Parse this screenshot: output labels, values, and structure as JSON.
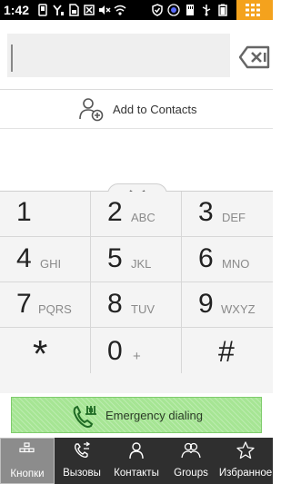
{
  "status_bar": {
    "time": "1:42",
    "icons_left": [
      "phone-icon",
      "signal-y-icon",
      "sim-card-icon",
      "no-sim-icon",
      "mute-icon",
      "wifi-icon"
    ],
    "icons_right": [
      "shield-icon",
      "sync-icon",
      "sd-card-icon",
      "usb-icon",
      "battery-icon"
    ],
    "grid_color": "#f4a21d"
  },
  "dialer": {
    "number_value": "",
    "add_to_contacts": "Add to Contacts",
    "keys": [
      {
        "digit": "1",
        "letters": ""
      },
      {
        "digit": "2",
        "letters": "ABC"
      },
      {
        "digit": "3",
        "letters": "DEF"
      },
      {
        "digit": "4",
        "letters": "GHI"
      },
      {
        "digit": "5",
        "letters": "JKL"
      },
      {
        "digit": "6",
        "letters": "MNO"
      },
      {
        "digit": "7",
        "letters": "PQRS"
      },
      {
        "digit": "8",
        "letters": "TUV"
      },
      {
        "digit": "9",
        "letters": "WXYZ"
      },
      {
        "digit": "*",
        "letters": ""
      },
      {
        "digit": "0",
        "letters": "+"
      },
      {
        "digit": "#",
        "letters": ""
      }
    ],
    "emergency_label": "Emergency dialing",
    "emergency_color": "#a6e594"
  },
  "tabs": [
    {
      "label": "Кнопки",
      "icon": "dialpad-icon",
      "active": true
    },
    {
      "label": "Вызовы",
      "icon": "call-log-icon",
      "active": false
    },
    {
      "label": "Контакты",
      "icon": "person-icon",
      "active": false
    },
    {
      "label": "Groups",
      "icon": "group-icon",
      "active": false
    },
    {
      "label": "Избранное",
      "icon": "star-icon",
      "active": false
    }
  ]
}
